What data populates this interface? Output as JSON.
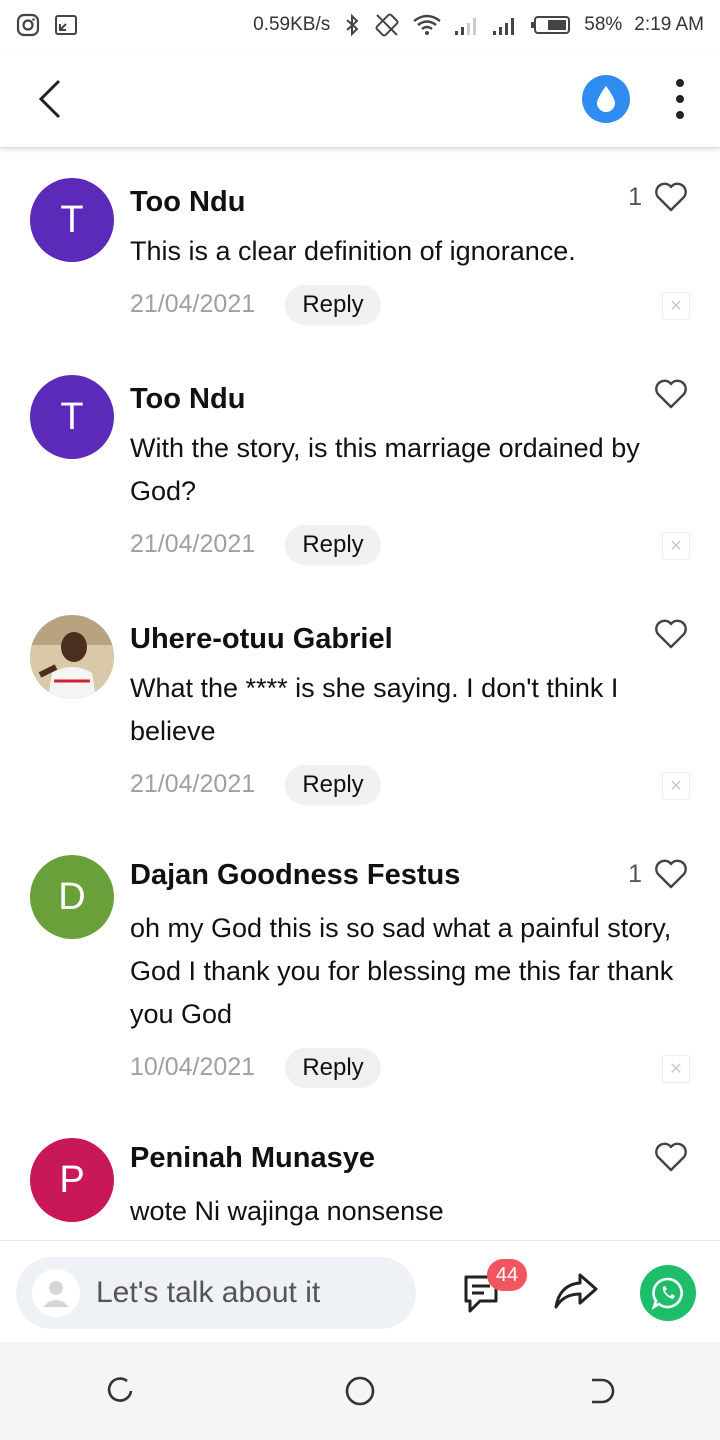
{
  "status": {
    "speed": "0.59KB/s",
    "battery": "58%",
    "time": "2:19 AM",
    "icons": [
      "instagram-icon",
      "screen-icon",
      "bluetooth-icon",
      "rotate-icon",
      "wifi-icon",
      "signal-icon",
      "signal-icon",
      "battery-icon"
    ]
  },
  "appbar": {
    "back_icon": "chevron-left-icon",
    "drop_icon": "water-drop-icon",
    "more_icon": "more-vertical-icon"
  },
  "comments": [
    {
      "initial": "T",
      "avatar_color": "#5b2ab8",
      "name": "Too Ndu",
      "text": "This is a clear definition of ignorance.",
      "date": "21/04/2021",
      "reply": "Reply",
      "likes": "1"
    },
    {
      "initial": "T",
      "avatar_color": "#5b2ab8",
      "name": "Too Ndu",
      "text": "With the story, is this marriage ordained by God?",
      "date": "21/04/2021",
      "reply": "Reply",
      "likes": ""
    },
    {
      "initial": "",
      "avatar_color": "#c9b59a",
      "name": "Uhere-otuu Gabriel",
      "text": "What the **** is she saying. I don't think I believe",
      "date": "21/04/2021",
      "reply": "Reply",
      "likes": ""
    },
    {
      "initial": "D",
      "avatar_color": "#6aa03a",
      "name": "Dajan Goodness Festus",
      "text": "oh my God this is so sad what a painful story, God I thank you for blessing me this far thank you God",
      "date": "10/04/2021",
      "reply": "Reply",
      "likes": "1"
    },
    {
      "initial": "P",
      "avatar_color": "#c8185a",
      "name": "Peninah Munasye",
      "text": "wote Ni wajinga nonsense",
      "date": "",
      "reply": "",
      "likes": ""
    }
  ],
  "input": {
    "placeholder": "Let's talk about it",
    "badge": "44"
  },
  "colors": {
    "accent": "#2f8cf0",
    "whatsapp": "#1ebd6a",
    "badge": "#f05560"
  }
}
